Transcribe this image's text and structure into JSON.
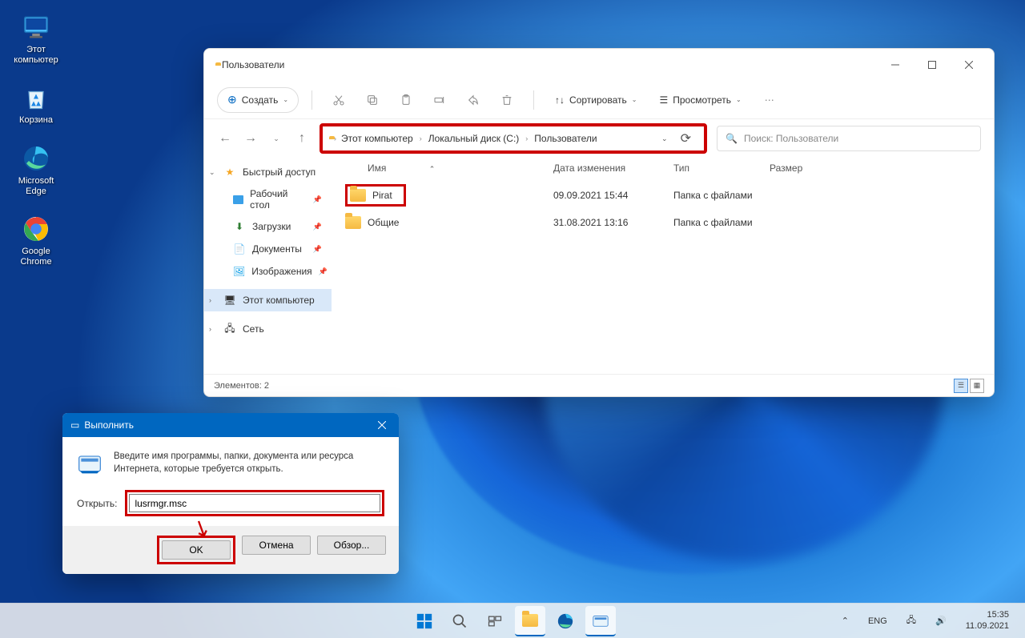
{
  "desktop": {
    "icons": [
      {
        "name": "this-pc",
        "label": "Этот\nкомпьютер"
      },
      {
        "name": "recycle-bin",
        "label": "Корзина"
      },
      {
        "name": "edge",
        "label": "Microsoft\nEdge"
      },
      {
        "name": "chrome",
        "label": "Google\nChrome"
      }
    ]
  },
  "explorer": {
    "title": "Пользователи",
    "toolbar": {
      "create": "Создать",
      "sort": "Сортировать",
      "view": "Просмотреть"
    },
    "breadcrumb": [
      "Этот компьютер",
      "Локальный диск (C:)",
      "Пользователи"
    ],
    "search_placeholder": "Поиск: Пользователи",
    "sidebar": {
      "quick": "Быстрый доступ",
      "items": [
        {
          "label": "Рабочий стол"
        },
        {
          "label": "Загрузки"
        },
        {
          "label": "Документы"
        },
        {
          "label": "Изображения"
        }
      ],
      "thispc": "Этот компьютер",
      "network": "Сеть"
    },
    "columns": {
      "name": "Имя",
      "date": "Дата изменения",
      "type": "Тип",
      "size": "Размер"
    },
    "rows": [
      {
        "name": "Pirat",
        "date": "09.09.2021 15:44",
        "type": "Папка с файлами",
        "highlight": true
      },
      {
        "name": "Общие",
        "date": "31.08.2021 13:16",
        "type": "Папка с файлами",
        "highlight": false
      }
    ],
    "status": "Элементов: 2"
  },
  "run": {
    "title": "Выполнить",
    "description": "Введите имя программы, папки, документа или ресурса Интернета, которые требуется открыть.",
    "open_label": "Открыть:",
    "input": "lusrmgr.msc",
    "ok": "OK",
    "cancel": "Отмена",
    "browse": "Обзор..."
  },
  "taskbar": {
    "lang": "ENG",
    "time": "15:35",
    "date": "11.09.2021"
  }
}
